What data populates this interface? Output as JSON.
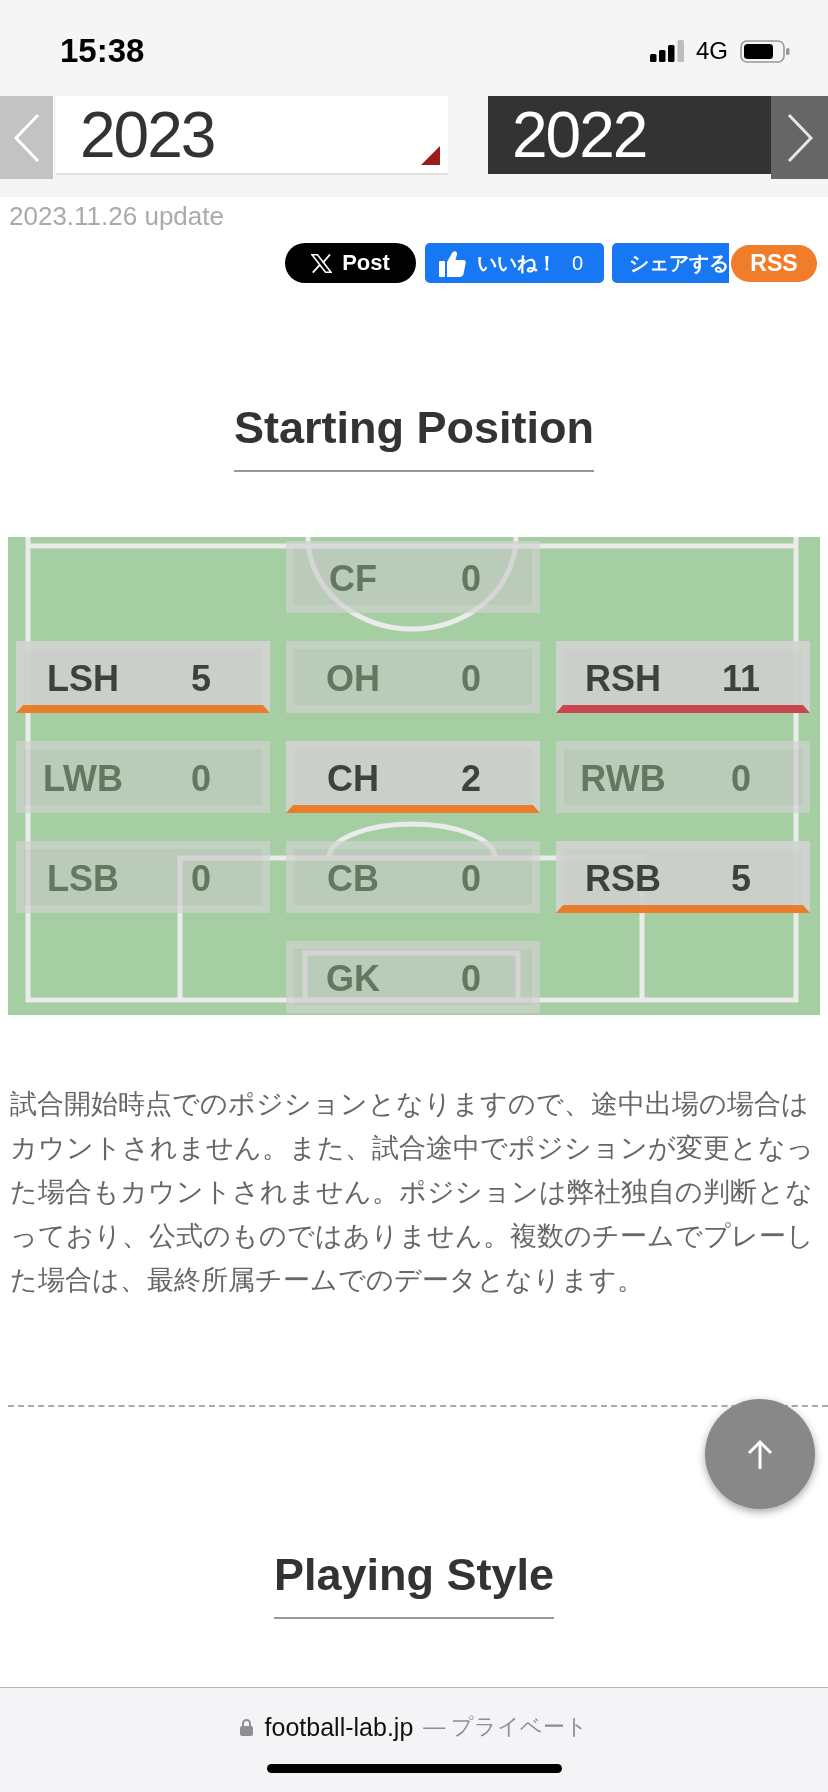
{
  "status_bar": {
    "time": "15:38",
    "network": "4G"
  },
  "season_nav": {
    "current": {
      "label": "2023"
    },
    "other": {
      "label": "2022"
    }
  },
  "updated": "2023.11.26 update",
  "share_buttons": [
    {
      "kind": "x",
      "label": "Post"
    },
    {
      "kind": "like",
      "label": "いいね！",
      "count": "0"
    },
    {
      "kind": "share",
      "label": "シェアする"
    },
    {
      "kind": "rss",
      "label": "RSS"
    }
  ],
  "starting_position": {
    "title": "Starting Position",
    "rows": [
      [
        {
          "position": "CF",
          "count": "0",
          "active": false
        }
      ],
      [
        {
          "position": "LSH",
          "count": "5",
          "active": true,
          "color": "#e87d2e"
        },
        {
          "position": "OH",
          "count": "0",
          "active": false
        },
        {
          "position": "RSH",
          "count": "11",
          "active": true,
          "color": "#c8464f"
        }
      ],
      [
        {
          "position": "LWB",
          "count": "0",
          "active": false
        },
        {
          "position": "CH",
          "count": "2",
          "active": true,
          "color": "#e87d2e"
        },
        {
          "position": "RWB",
          "count": "0",
          "active": false
        }
      ],
      [
        {
          "position": "LSB",
          "count": "0",
          "active": false
        },
        {
          "position": "CB",
          "count": "0",
          "active": false
        },
        {
          "position": "RSB",
          "count": "5",
          "active": true,
          "color": "#e87d2e"
        }
      ],
      [
        {
          "position": "GK",
          "count": "0",
          "active": false
        }
      ]
    ],
    "note": "試合開始時点でのポジションとなりますので、途中出場の場合はカウントされません。また、試合途中でポジションが変更となった場合もカウントされません。ポジションは弊社独自の判断となっており、公式のものではありません。複数のチームでプレーした場合は、最終所属チームでのデータとなります。"
  },
  "next_section": {
    "title": "Playing Style"
  },
  "browser_bar": {
    "domain": "football-lab.jp",
    "mode": "— プライベート"
  }
}
